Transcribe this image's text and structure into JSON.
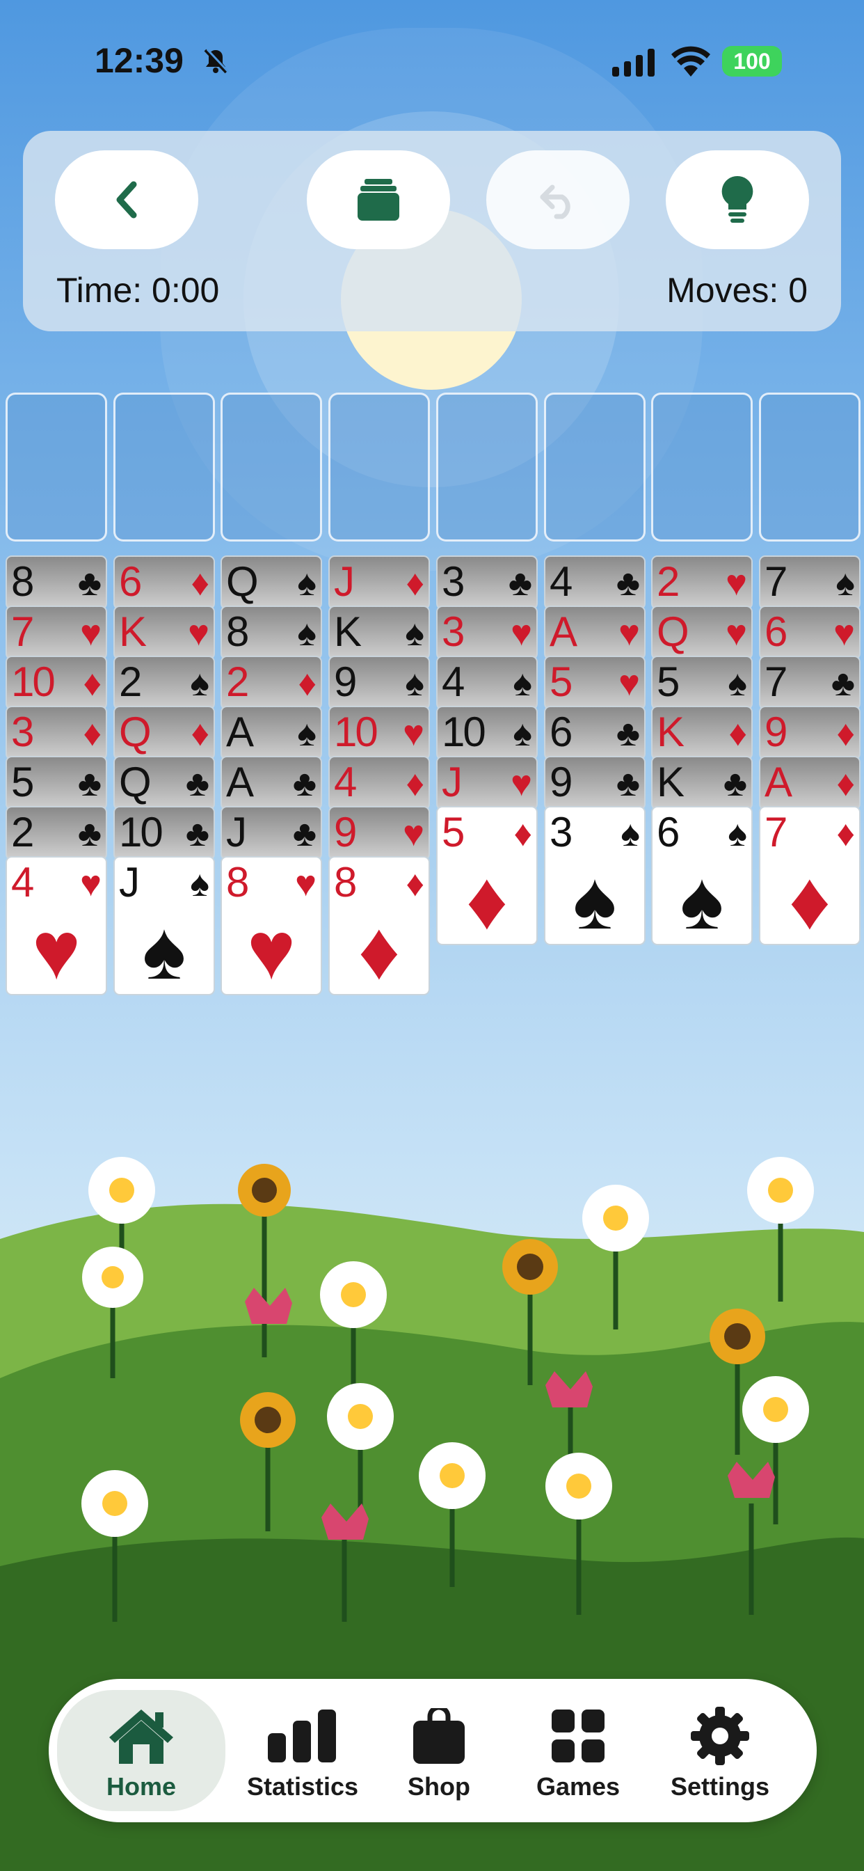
{
  "status_bar": {
    "time": "12:39",
    "battery": "100"
  },
  "toolbar": {
    "time_label": "Time: 0:00",
    "moves_label": "Moves: 0",
    "buttons": [
      "back",
      "deck",
      "undo",
      "hint"
    ]
  },
  "colors": {
    "accent": "#1f6b4a",
    "card_red": "#cf1a2b",
    "card_black": "#111111"
  },
  "tableau": [
    [
      {
        "r": "8",
        "s": "♣"
      },
      {
        "r": "7",
        "s": "♥"
      },
      {
        "r": "10",
        "s": "♦"
      },
      {
        "r": "3",
        "s": "♦"
      },
      {
        "r": "5",
        "s": "♣"
      },
      {
        "r": "2",
        "s": "♣"
      },
      {
        "r": "4",
        "s": "♥"
      }
    ],
    [
      {
        "r": "6",
        "s": "♦"
      },
      {
        "r": "K",
        "s": "♥"
      },
      {
        "r": "2",
        "s": "♠"
      },
      {
        "r": "Q",
        "s": "♦"
      },
      {
        "r": "Q",
        "s": "♣"
      },
      {
        "r": "10",
        "s": "♣"
      },
      {
        "r": "J",
        "s": "♠"
      }
    ],
    [
      {
        "r": "Q",
        "s": "♠"
      },
      {
        "r": "8",
        "s": "♠"
      },
      {
        "r": "2",
        "s": "♦"
      },
      {
        "r": "A",
        "s": "♠"
      },
      {
        "r": "A",
        "s": "♣"
      },
      {
        "r": "J",
        "s": "♣"
      },
      {
        "r": "8",
        "s": "♥"
      }
    ],
    [
      {
        "r": "J",
        "s": "♦"
      },
      {
        "r": "K",
        "s": "♠"
      },
      {
        "r": "9",
        "s": "♠"
      },
      {
        "r": "10",
        "s": "♥"
      },
      {
        "r": "4",
        "s": "♦"
      },
      {
        "r": "9",
        "s": "♥"
      },
      {
        "r": "8",
        "s": "♦"
      }
    ],
    [
      {
        "r": "3",
        "s": "♣"
      },
      {
        "r": "3",
        "s": "♥"
      },
      {
        "r": "4",
        "s": "♠"
      },
      {
        "r": "10",
        "s": "♠"
      },
      {
        "r": "J",
        "s": "♥"
      },
      {
        "r": "5",
        "s": "♦"
      }
    ],
    [
      {
        "r": "4",
        "s": "♣"
      },
      {
        "r": "A",
        "s": "♥"
      },
      {
        "r": "5",
        "s": "♥"
      },
      {
        "r": "6",
        "s": "♣"
      },
      {
        "r": "9",
        "s": "♣"
      },
      {
        "r": "3",
        "s": "♠"
      }
    ],
    [
      {
        "r": "2",
        "s": "♥"
      },
      {
        "r": "Q",
        "s": "♥"
      },
      {
        "r": "5",
        "s": "♠"
      },
      {
        "r": "K",
        "s": "♦"
      },
      {
        "r": "K",
        "s": "♣"
      },
      {
        "r": "6",
        "s": "♠"
      }
    ],
    [
      {
        "r": "7",
        "s": "♠"
      },
      {
        "r": "6",
        "s": "♥"
      },
      {
        "r": "7",
        "s": "♣"
      },
      {
        "r": "9",
        "s": "♦"
      },
      {
        "r": "A",
        "s": "♦"
      },
      {
        "r": "7",
        "s": "♦"
      }
    ]
  ],
  "nav": {
    "items": [
      {
        "label": "Home",
        "icon": "home-icon",
        "active": true
      },
      {
        "label": "Statistics",
        "icon": "bar-chart-icon",
        "active": false
      },
      {
        "label": "Shop",
        "icon": "shopping-bag-icon",
        "active": false
      },
      {
        "label": "Games",
        "icon": "grid-icon",
        "active": false
      },
      {
        "label": "Settings",
        "icon": "gear-icon",
        "active": false
      }
    ]
  }
}
